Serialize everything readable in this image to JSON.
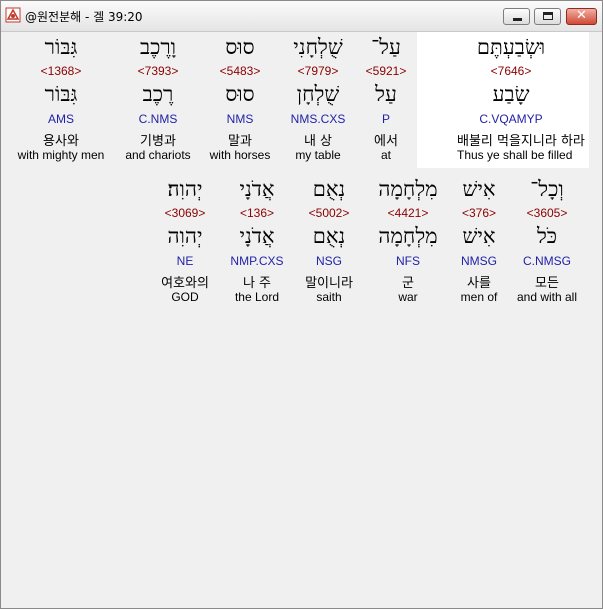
{
  "window": {
    "title": "@원전분해 - 겔 39:20",
    "close_symbol": "✕"
  },
  "row1": [
    {
      "hebrew": "וּשְׂבַעְתֶּם",
      "strong": "<7646>",
      "lexeme": "שָׂבַע",
      "morph": "C.VQAMYP",
      "korean": "배불리 먹을지니라 하라",
      "english": "Thus ye shall be filled"
    },
    {
      "hebrew": "עַל־",
      "strong": "<5921>",
      "lexeme": "עַל",
      "morph": "P",
      "korean": "에서",
      "english": "at"
    },
    {
      "hebrew": "שֻׁלְחָנִי",
      "strong": "<7979>",
      "lexeme": "שֻׁלְחָן",
      "morph": "NMS.CXS",
      "korean": "내 상",
      "english": "my table"
    },
    {
      "hebrew": "סוּס",
      "strong": "<5483>",
      "lexeme": "סוּס",
      "morph": "NMS",
      "korean": "말과",
      "english": "with horses"
    },
    {
      "hebrew": "וָרֶכֶב",
      "strong": "<7393>",
      "lexeme": "רֶכֶב",
      "morph": "C.NMS",
      "korean": "기병과",
      "english": "and chariots"
    },
    {
      "hebrew": "גִּבּוֹר",
      "strong": "<1368>",
      "lexeme": "גִּבּוֹר",
      "morph": "AMS",
      "korean": "용사와",
      "english": "with mighty men"
    }
  ],
  "row2": [
    {
      "hebrew": "וְכָל־",
      "strong": "<3605>",
      "lexeme": "כֹּל",
      "morph": "C.NMSG",
      "korean": "모든",
      "english": "and with all"
    },
    {
      "hebrew": "אִישׁ",
      "strong": "<376>",
      "lexeme": "אִישׁ",
      "morph": "NMSG",
      "korean": "사를",
      "english": "men of"
    },
    {
      "hebrew": "מִלְחָמָה",
      "strong": "<4421>",
      "lexeme": "מִלְחָמָה",
      "morph": "NFS",
      "korean": "군",
      "english": "war"
    },
    {
      "hebrew": "נְאֻם",
      "strong": "<5002>",
      "lexeme": "נְאֻם",
      "morph": "NSG",
      "korean": "말이니라",
      "english": "saith"
    },
    {
      "hebrew": "אֲדֹנָי",
      "strong": "<136>",
      "lexeme": "אֲדֹנָי",
      "morph": "NMP.CXS",
      "korean": "나 주",
      "english": "the Lord"
    },
    {
      "hebrew": "יְהוִה׃",
      "strong": "<3069>",
      "lexeme": "יְהוִה",
      "morph": "NE",
      "korean": "여호와의",
      "english": "GOD"
    }
  ]
}
